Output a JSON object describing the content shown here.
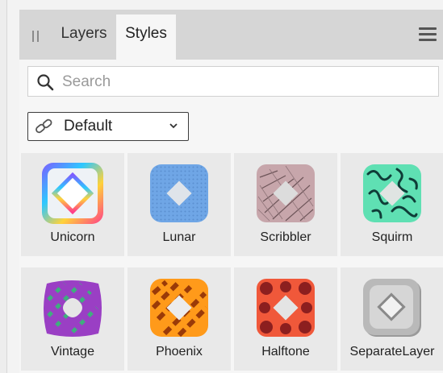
{
  "tabs": [
    {
      "label": "Layers",
      "active": false
    },
    {
      "label": "Styles",
      "active": true
    }
  ],
  "search": {
    "placeholder": "Search"
  },
  "category_select": {
    "selected": "Default"
  },
  "styles": [
    {
      "name": "Unicorn"
    },
    {
      "name": "Lunar"
    },
    {
      "name": "Scribbler"
    },
    {
      "name": "Squirm"
    },
    {
      "name": "Vintage"
    },
    {
      "name": "Phoenix"
    },
    {
      "name": "Halftone"
    },
    {
      "name": "SeparateLayer"
    }
  ],
  "icons": {
    "grip": "grip-handle-icon",
    "menu": "hamburger-menu-icon",
    "search": "search-icon",
    "link": "link-icon",
    "chevron": "chevron-down-icon"
  },
  "colors": {
    "tabbar_bg": "#d6d6d6",
    "panel_bg": "#f6f6f6",
    "tile_bg": "#e9e9e9"
  }
}
